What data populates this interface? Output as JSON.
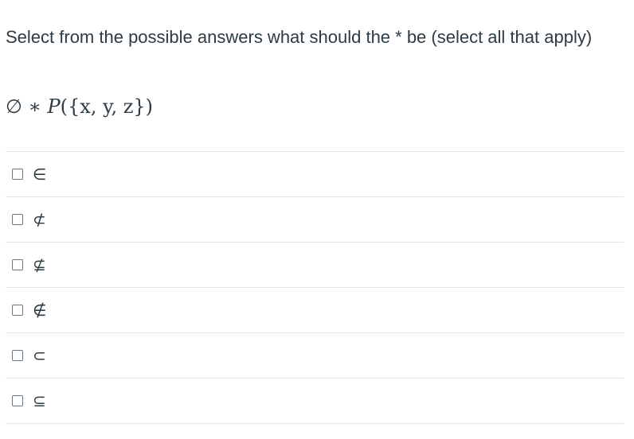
{
  "question": {
    "text": "Select from the possible answers what should the * be (select all that apply)"
  },
  "expression": {
    "empty_set": "∅",
    "operator": "∗",
    "func": "P",
    "argument": "({x, y, z})"
  },
  "answers": [
    {
      "label": "∈",
      "checked": false
    },
    {
      "label": "⊄",
      "checked": false
    },
    {
      "label": "⊈",
      "checked": false
    },
    {
      "label": "∉",
      "checked": false
    },
    {
      "label": "⊂",
      "checked": false
    },
    {
      "label": "⊆",
      "checked": false
    }
  ]
}
